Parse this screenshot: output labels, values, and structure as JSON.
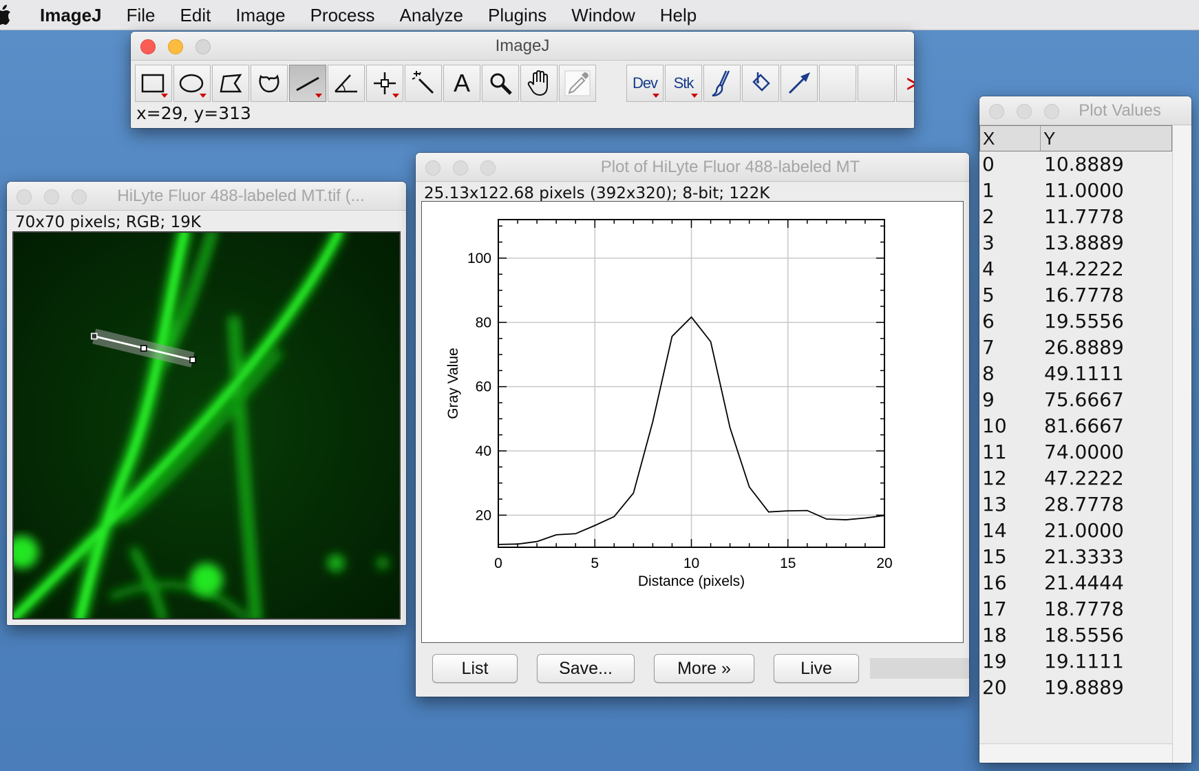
{
  "menubar": {
    "app_name": "ImageJ",
    "items": [
      "File",
      "Edit",
      "Image",
      "Process",
      "Analyze",
      "Plugins",
      "Window",
      "Help"
    ]
  },
  "toolbar_window": {
    "title": "ImageJ",
    "status": "x=29, y=313",
    "tools": [
      {
        "icon": "rectangle-icon",
        "dropdown": true
      },
      {
        "icon": "oval-icon",
        "dropdown": true
      },
      {
        "icon": "polygon-icon",
        "dropdown": false
      },
      {
        "icon": "freehand-icon",
        "dropdown": false
      },
      {
        "icon": "straight-line-icon",
        "dropdown": true,
        "selected": true
      },
      {
        "icon": "angle-icon",
        "dropdown": false
      },
      {
        "icon": "point-icon",
        "dropdown": true
      },
      {
        "icon": "wand-icon",
        "dropdown": false
      },
      {
        "icon": "text-icon",
        "label": "A",
        "dropdown": false
      },
      {
        "icon": "magnifier-icon",
        "dropdown": false
      },
      {
        "icon": "hand-icon",
        "dropdown": false
      },
      {
        "icon": "eyedropper-icon",
        "dropdown": false
      },
      {
        "icon": "dev-menu-icon",
        "label": "Dev",
        "dropdown": true
      },
      {
        "icon": "stk-menu-icon",
        "label": "Stk",
        "dropdown": true
      },
      {
        "icon": "brush-icon",
        "dropdown": false
      },
      {
        "icon": "flood-fill-icon",
        "dropdown": false
      },
      {
        "icon": "arrow-icon",
        "dropdown": false
      },
      {
        "icon": "empty-slot",
        "dropdown": false
      },
      {
        "icon": "empty-slot",
        "dropdown": false
      },
      {
        "icon": "more-tools-icon",
        "label": "≫",
        "dropdown": false
      }
    ]
  },
  "image_window": {
    "title": "HiLyte Fluor 488-labeled MT.tif (...",
    "info": "70x70 pixels; RGB; 19K",
    "line_roi": {
      "from": [
        14,
        18
      ],
      "to": [
        33,
        23
      ]
    }
  },
  "plot_window": {
    "title": "Plot of HiLyte Fluor 488-labeled MT",
    "info": "25.13x122.68 pixels (392x320); 8-bit; 122K",
    "buttons": {
      "list": "List",
      "save": "Save...",
      "more": "More »",
      "live": "Live"
    }
  },
  "chart_data": {
    "type": "line",
    "xlabel": "Distance (pixels)",
    "ylabel": "Gray Value",
    "xlim": [
      0,
      20
    ],
    "ylim": [
      10,
      112
    ],
    "xticks": [
      0,
      5,
      10,
      15,
      20
    ],
    "yticks": [
      20,
      40,
      60,
      80,
      100
    ],
    "grid": true,
    "x": [
      0,
      1,
      2,
      3,
      4,
      5,
      6,
      7,
      8,
      9,
      10,
      11,
      12,
      13,
      14,
      15,
      16,
      17,
      18,
      19,
      20
    ],
    "y": [
      10.8889,
      11.0,
      11.7778,
      13.8889,
      14.2222,
      16.7778,
      19.5556,
      26.8889,
      49.1111,
      75.6667,
      81.6667,
      74.0,
      47.2222,
      28.7778,
      21.0,
      21.3333,
      21.4444,
      18.7778,
      18.5556,
      19.1111,
      19.8889
    ]
  },
  "values_window": {
    "title": "Plot Values",
    "headers": {
      "x": "X",
      "y": "Y"
    },
    "rows": [
      {
        "x": "0",
        "y": "10.8889"
      },
      {
        "x": "1",
        "y": "11.0000"
      },
      {
        "x": "2",
        "y": "11.7778"
      },
      {
        "x": "3",
        "y": "13.8889"
      },
      {
        "x": "4",
        "y": "14.2222"
      },
      {
        "x": "5",
        "y": "16.7778"
      },
      {
        "x": "6",
        "y": "19.5556"
      },
      {
        "x": "7",
        "y": "26.8889"
      },
      {
        "x": "8",
        "y": "49.1111"
      },
      {
        "x": "9",
        "y": "75.6667"
      },
      {
        "x": "10",
        "y": "81.6667"
      },
      {
        "x": "11",
        "y": "74.0000"
      },
      {
        "x": "12",
        "y": "47.2222"
      },
      {
        "x": "13",
        "y": "28.7778"
      },
      {
        "x": "14",
        "y": "21.0000"
      },
      {
        "x": "15",
        "y": "21.3333"
      },
      {
        "x": "16",
        "y": "21.4444"
      },
      {
        "x": "17",
        "y": "18.7778"
      },
      {
        "x": "18",
        "y": "18.5556"
      },
      {
        "x": "19",
        "y": "19.1111"
      },
      {
        "x": "20",
        "y": "19.8889"
      }
    ]
  }
}
